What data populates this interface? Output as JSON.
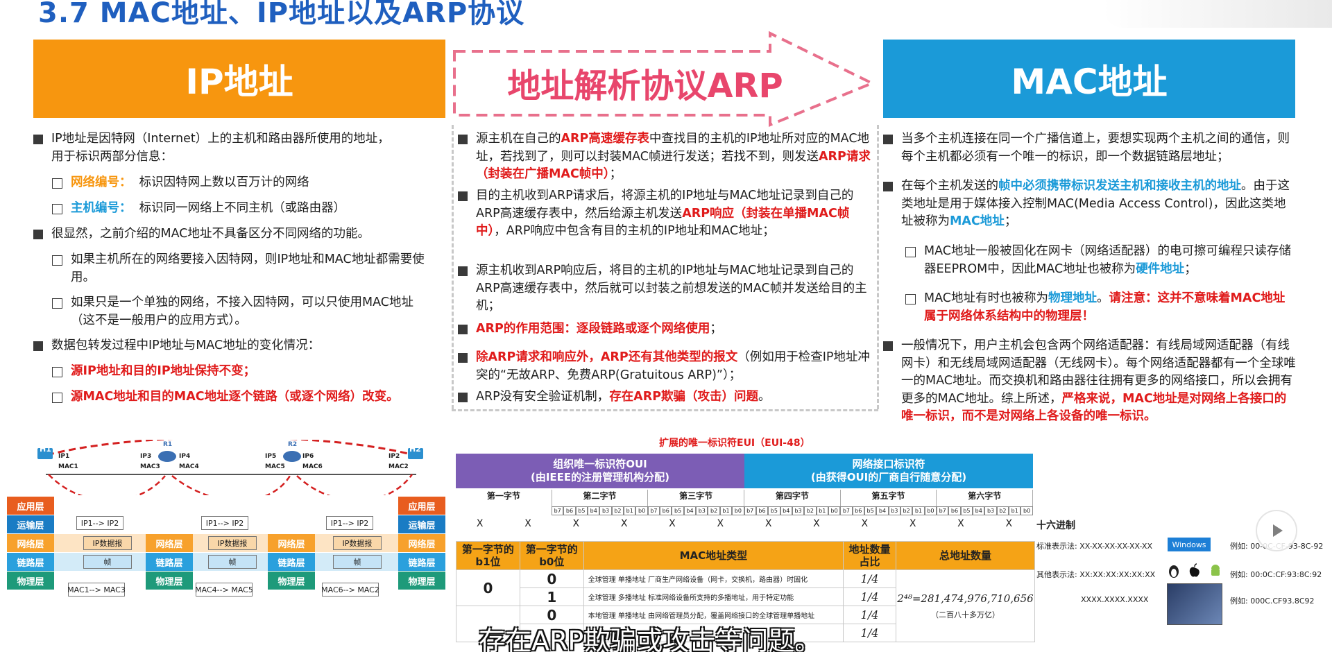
{
  "title": "3.7 MAC地址、IP地址以及ARP协议",
  "headers": {
    "ip": "IP地址",
    "arp": "地址解析协议ARP",
    "mac": "MAC地址"
  },
  "colors": {
    "ip": "#f7960f",
    "mac": "#1b9ad8",
    "arp": "#e8466c",
    "oui": "#7c5db5",
    "red": "#e01b1b"
  },
  "ip": {
    "b1a": "IP地址是因特网（Internet）上的主机和路由器所使用的地址，",
    "b1b": "用于标识两部分信息：",
    "c1_label": "网络编号：",
    "c1_text": "标识因特网上数以百万计的网络",
    "c2_label": "主机编号：",
    "c2_text": "标识同一网络上不同主机（或路由器）",
    "b2": "很显然，之前介绍的MAC地址不具备区分不同网络的功能。",
    "c3": "如果主机所在的网络要接入因特网，则IP地址和MAC地址都需要使用。",
    "c4": "如果只是一个单独的网络，不接入因特网，可以只使用MAC地址（这不是一般用户的应用方式）。",
    "b3": "数据包转发过程中IP地址与MAC地址的变化情况：",
    "c5": "源IP地址和目的IP地址保持不变；",
    "c6": "源MAC地址和目的MAC地址逐个链路（或逐个网络）改变。"
  },
  "arp": {
    "p1a": "源主机在自己的",
    "p1b": "ARP高速缓存表",
    "p1c": "中查找目的主机的IP地址所对应的MAC地址，若找到了，则可以封装MAC帧进行发送；若找不到，则发送",
    "p1d": "ARP请求（封装在广播MAC帧中）",
    "p1e": "；",
    "p2a": "目的主机收到ARP请求后，将源主机的IP地址与MAC地址记录到自己的ARP高速缓存表中，然后给源主机发送",
    "p2b": "ARP响应（封装在单播MAC帧中）",
    "p2c": "，ARP响应中包含有目的主机的IP地址和MAC地址；",
    "p3": "源主机收到ARP响应后，将目的主机的IP地址与MAC地址记录到自己的ARP高速缓存表中，然后就可以封装之前想发送的MAC帧并发送给目的主机；",
    "p4": "ARP的作用范围：逐段链路或逐个网络使用",
    "p4e": "；",
    "p5a": "除ARP请求和响应外，ARP还有其他类型的报文",
    "p5b": "（例如用于检查IP地址冲突的“无故ARP、免费ARP(Gratuitous ARP)”）；",
    "p6a": "ARP没有安全验证机制，",
    "p6b": "存在ARP欺骗（攻击）问题",
    "p6c": "。"
  },
  "mac": {
    "p1": "当多个主机连接在同一个广播信道上，要想实现两个主机之间的通信，则每个主机都必须有一个唯一的标识，即一个数据链路层地址；",
    "p2a": "在每个主机发送的",
    "p2b": "帧中必须携带标识发送主机和接收主机的地址",
    "p2c": "。由于这类地址是用于媒体接入控制MAC(Media Access Control)，因此这类地址被称为",
    "p2d": "MAC地址",
    "p2e": "；",
    "c1a": "MAC地址一般被固化在网卡（网络适配器）的电可擦可编程只读存储器EEPROM中，因此MAC地址也被称为",
    "c1b": "硬件地址",
    "c1c": "；",
    "c2a": "MAC地址有时也被称为",
    "c2b": "物理地址",
    "c2c": "。",
    "c2d": "请注意：这并不意味着MAC地址属于网络体系结构中的物理层！",
    "p3a": "一般情况下，用户主机会包含两个网络适配器：有线局域网适配器（有线网卡）和无线局域网适配器（无线网卡）。每个网络适配器都有一个全球唯一的MAC地址。而交换机和路由器往往拥有更多的网络接口，所以会拥有更多的MAC地址。综上所述，",
    "p3b": "严格来说，MAC地址是对网络上各接口的唯一标识，而不是对网络上各设备的唯一标识。"
  },
  "diagram": {
    "h1": "H1",
    "h2": "H2",
    "r1": "R1",
    "r2": "R2",
    "labels": [
      "IP1",
      "MAC1",
      "IP3",
      "MAC3",
      "IP4",
      "MAC4",
      "IP5",
      "MAC5",
      "IP6",
      "MAC6",
      "IP2",
      "MAC2"
    ],
    "layers": [
      "应用层",
      "运输层",
      "网络层",
      "链路层",
      "物理层"
    ],
    "ipflow": "IP1--> IP2",
    "packet": "IP数据报",
    "frame": "帧",
    "macflows": [
      "MAC1--> MAC3",
      "MAC4--> MAC5",
      "MAC6--> MAC2"
    ]
  },
  "eui": {
    "caption": "扩展的唯一标识符EUI（EUI-48）",
    "oui1": "组织唯一标识符OUI",
    "oui2": "(由IEEE的注册管理机构分配)",
    "nic1": "网络接口标识符",
    "nic2": "(由获得OUI的厂商自行随意分配)",
    "bytes": [
      "第一字节",
      "第二字节",
      "第三字节",
      "第四字节",
      "第五字节",
      "第六字节"
    ],
    "bits": [
      "b7",
      "b6",
      "b5",
      "b4",
      "b3",
      "b2",
      "b1",
      "b0"
    ],
    "x": "X",
    "hex": "十六进制"
  },
  "mactype": {
    "headers": [
      "第一字节的b1位",
      "第一字节的b0位",
      "MAC地址类型",
      "地址数量占比",
      "总地址数量"
    ],
    "b1": "0",
    "rows": [
      {
        "b0": "0",
        "type": "全球管理  单播地址  厂商生产网络设备（网卡，交换机，路由器）时固化",
        "ratio": "1/4"
      },
      {
        "b0": "1",
        "type": "全球管理  多播地址  标准网络设备所支持的多播地址，用于特定功能",
        "ratio": "1/4"
      },
      {
        "b0": "0",
        "type": "本地管理  单播地址  由网络管理员分配，覆盖网络接口的全球管理单播地址",
        "ratio": "1/4"
      },
      {
        "b0": "",
        "type": "",
        "ratio": "1/4"
      }
    ],
    "total": "2⁴⁸=281,474,976,710,656",
    "total_cn": "（二百八十多万亿）"
  },
  "formats": {
    "std": "标准表示法: XX-XX-XX-XX-XX-XX",
    "win": "Windows",
    "ex1": "例如:  00-0C-CF-93-8C-92",
    "other": "其他表示法: XX:XX:XX:XX:XX:XX",
    "ex2": "例如:  00:0C:CF:93:8C:92",
    "dot": "XXXX.XXXX.XXXX",
    "ex3": "例如:  000C.CF93.8C92"
  },
  "subtitle": "存在ARP欺骗或攻击等问题。"
}
